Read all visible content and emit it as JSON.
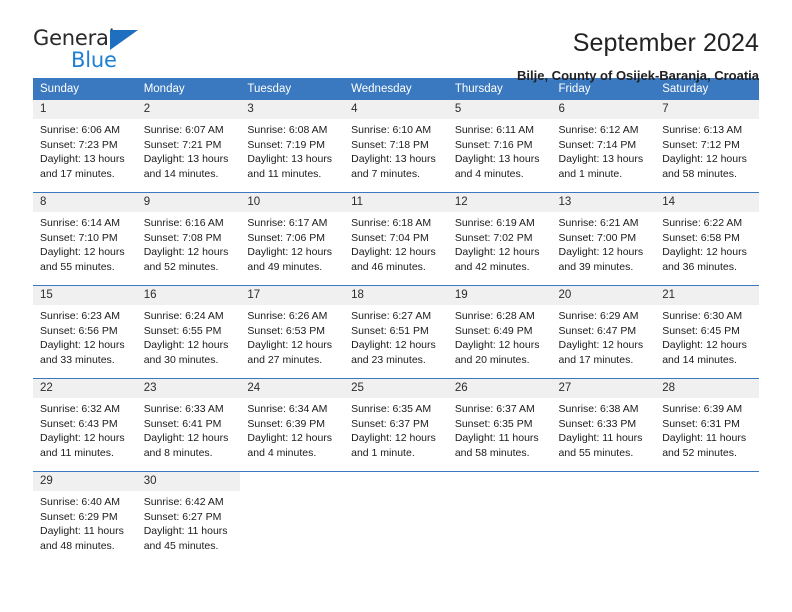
{
  "brand": {
    "name_top": "General",
    "name_bottom": "Blue",
    "triangle_color": "#1f6fc0",
    "blue_color": "#1f7fd4"
  },
  "header": {
    "title": "September 2024",
    "subtitle": "Bilje, County of Osijek-Baranja, Croatia"
  },
  "theme": {
    "header_blue": "#3a78bf",
    "daynum_band": "#f0f0f0",
    "text": "#1b1b1b"
  },
  "weekday_headers": [
    "Sunday",
    "Monday",
    "Tuesday",
    "Wednesday",
    "Thursday",
    "Friday",
    "Saturday"
  ],
  "weeks": [
    [
      {
        "day": "1",
        "sunrise": "Sunrise: 6:06 AM",
        "sunset": "Sunset: 7:23 PM",
        "daylight_1": "Daylight: 13 hours",
        "daylight_2": "and 17 minutes."
      },
      {
        "day": "2",
        "sunrise": "Sunrise: 6:07 AM",
        "sunset": "Sunset: 7:21 PM",
        "daylight_1": "Daylight: 13 hours",
        "daylight_2": "and 14 minutes."
      },
      {
        "day": "3",
        "sunrise": "Sunrise: 6:08 AM",
        "sunset": "Sunset: 7:19 PM",
        "daylight_1": "Daylight: 13 hours",
        "daylight_2": "and 11 minutes."
      },
      {
        "day": "4",
        "sunrise": "Sunrise: 6:10 AM",
        "sunset": "Sunset: 7:18 PM",
        "daylight_1": "Daylight: 13 hours",
        "daylight_2": "and 7 minutes."
      },
      {
        "day": "5",
        "sunrise": "Sunrise: 6:11 AM",
        "sunset": "Sunset: 7:16 PM",
        "daylight_1": "Daylight: 13 hours",
        "daylight_2": "and 4 minutes."
      },
      {
        "day": "6",
        "sunrise": "Sunrise: 6:12 AM",
        "sunset": "Sunset: 7:14 PM",
        "daylight_1": "Daylight: 13 hours",
        "daylight_2": "and 1 minute."
      },
      {
        "day": "7",
        "sunrise": "Sunrise: 6:13 AM",
        "sunset": "Sunset: 7:12 PM",
        "daylight_1": "Daylight: 12 hours",
        "daylight_2": "and 58 minutes."
      }
    ],
    [
      {
        "day": "8",
        "sunrise": "Sunrise: 6:14 AM",
        "sunset": "Sunset: 7:10 PM",
        "daylight_1": "Daylight: 12 hours",
        "daylight_2": "and 55 minutes."
      },
      {
        "day": "9",
        "sunrise": "Sunrise: 6:16 AM",
        "sunset": "Sunset: 7:08 PM",
        "daylight_1": "Daylight: 12 hours",
        "daylight_2": "and 52 minutes."
      },
      {
        "day": "10",
        "sunrise": "Sunrise: 6:17 AM",
        "sunset": "Sunset: 7:06 PM",
        "daylight_1": "Daylight: 12 hours",
        "daylight_2": "and 49 minutes."
      },
      {
        "day": "11",
        "sunrise": "Sunrise: 6:18 AM",
        "sunset": "Sunset: 7:04 PM",
        "daylight_1": "Daylight: 12 hours",
        "daylight_2": "and 46 minutes."
      },
      {
        "day": "12",
        "sunrise": "Sunrise: 6:19 AM",
        "sunset": "Sunset: 7:02 PM",
        "daylight_1": "Daylight: 12 hours",
        "daylight_2": "and 42 minutes."
      },
      {
        "day": "13",
        "sunrise": "Sunrise: 6:21 AM",
        "sunset": "Sunset: 7:00 PM",
        "daylight_1": "Daylight: 12 hours",
        "daylight_2": "and 39 minutes."
      },
      {
        "day": "14",
        "sunrise": "Sunrise: 6:22 AM",
        "sunset": "Sunset: 6:58 PM",
        "daylight_1": "Daylight: 12 hours",
        "daylight_2": "and 36 minutes."
      }
    ],
    [
      {
        "day": "15",
        "sunrise": "Sunrise: 6:23 AM",
        "sunset": "Sunset: 6:56 PM",
        "daylight_1": "Daylight: 12 hours",
        "daylight_2": "and 33 minutes."
      },
      {
        "day": "16",
        "sunrise": "Sunrise: 6:24 AM",
        "sunset": "Sunset: 6:55 PM",
        "daylight_1": "Daylight: 12 hours",
        "daylight_2": "and 30 minutes."
      },
      {
        "day": "17",
        "sunrise": "Sunrise: 6:26 AM",
        "sunset": "Sunset: 6:53 PM",
        "daylight_1": "Daylight: 12 hours",
        "daylight_2": "and 27 minutes."
      },
      {
        "day": "18",
        "sunrise": "Sunrise: 6:27 AM",
        "sunset": "Sunset: 6:51 PM",
        "daylight_1": "Daylight: 12 hours",
        "daylight_2": "and 23 minutes."
      },
      {
        "day": "19",
        "sunrise": "Sunrise: 6:28 AM",
        "sunset": "Sunset: 6:49 PM",
        "daylight_1": "Daylight: 12 hours",
        "daylight_2": "and 20 minutes."
      },
      {
        "day": "20",
        "sunrise": "Sunrise: 6:29 AM",
        "sunset": "Sunset: 6:47 PM",
        "daylight_1": "Daylight: 12 hours",
        "daylight_2": "and 17 minutes."
      },
      {
        "day": "21",
        "sunrise": "Sunrise: 6:30 AM",
        "sunset": "Sunset: 6:45 PM",
        "daylight_1": "Daylight: 12 hours",
        "daylight_2": "and 14 minutes."
      }
    ],
    [
      {
        "day": "22",
        "sunrise": "Sunrise: 6:32 AM",
        "sunset": "Sunset: 6:43 PM",
        "daylight_1": "Daylight: 12 hours",
        "daylight_2": "and 11 minutes."
      },
      {
        "day": "23",
        "sunrise": "Sunrise: 6:33 AM",
        "sunset": "Sunset: 6:41 PM",
        "daylight_1": "Daylight: 12 hours",
        "daylight_2": "and 8 minutes."
      },
      {
        "day": "24",
        "sunrise": "Sunrise: 6:34 AM",
        "sunset": "Sunset: 6:39 PM",
        "daylight_1": "Daylight: 12 hours",
        "daylight_2": "and 4 minutes."
      },
      {
        "day": "25",
        "sunrise": "Sunrise: 6:35 AM",
        "sunset": "Sunset: 6:37 PM",
        "daylight_1": "Daylight: 12 hours",
        "daylight_2": "and 1 minute."
      },
      {
        "day": "26",
        "sunrise": "Sunrise: 6:37 AM",
        "sunset": "Sunset: 6:35 PM",
        "daylight_1": "Daylight: 11 hours",
        "daylight_2": "and 58 minutes."
      },
      {
        "day": "27",
        "sunrise": "Sunrise: 6:38 AM",
        "sunset": "Sunset: 6:33 PM",
        "daylight_1": "Daylight: 11 hours",
        "daylight_2": "and 55 minutes."
      },
      {
        "day": "28",
        "sunrise": "Sunrise: 6:39 AM",
        "sunset": "Sunset: 6:31 PM",
        "daylight_1": "Daylight: 11 hours",
        "daylight_2": "and 52 minutes."
      }
    ],
    [
      {
        "day": "29",
        "sunrise": "Sunrise: 6:40 AM",
        "sunset": "Sunset: 6:29 PM",
        "daylight_1": "Daylight: 11 hours",
        "daylight_2": "and 48 minutes."
      },
      {
        "day": "30",
        "sunrise": "Sunrise: 6:42 AM",
        "sunset": "Sunset: 6:27 PM",
        "daylight_1": "Daylight: 11 hours",
        "daylight_2": "and 45 minutes."
      },
      {
        "day": "",
        "sunrise": "",
        "sunset": "",
        "daylight_1": "",
        "daylight_2": ""
      },
      {
        "day": "",
        "sunrise": "",
        "sunset": "",
        "daylight_1": "",
        "daylight_2": ""
      },
      {
        "day": "",
        "sunrise": "",
        "sunset": "",
        "daylight_1": "",
        "daylight_2": ""
      },
      {
        "day": "",
        "sunrise": "",
        "sunset": "",
        "daylight_1": "",
        "daylight_2": ""
      },
      {
        "day": "",
        "sunrise": "",
        "sunset": "",
        "daylight_1": "",
        "daylight_2": ""
      }
    ]
  ]
}
